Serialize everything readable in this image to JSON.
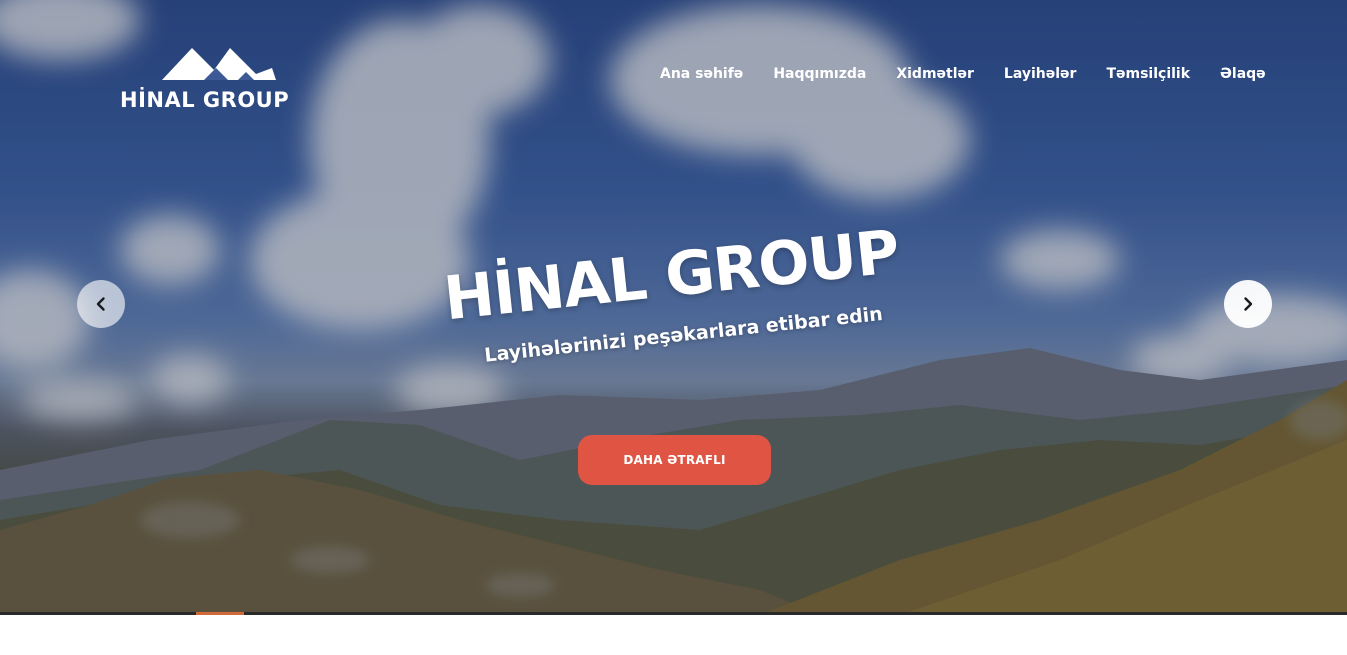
{
  "brand": {
    "name": "HİNAL GROUP",
    "accent_color": "#e05444"
  },
  "nav": {
    "items": [
      {
        "label": "Ana səhifə",
        "name": "nav-item-home"
      },
      {
        "label": "Haqqımızda",
        "name": "nav-item-about"
      },
      {
        "label": "Xidmətlər",
        "name": "nav-item-services"
      },
      {
        "label": "Layihələr",
        "name": "nav-item-projects"
      },
      {
        "label": "Təmsilçilik",
        "name": "nav-item-representation"
      },
      {
        "label": "Əlaqə",
        "name": "nav-item-contact"
      }
    ]
  },
  "hero": {
    "title": "HİNAL GROUP",
    "subtitle": "Layihələrinizi peşəkarlara etibar edin",
    "cta_label": "DAHA ƏTRAFLI",
    "prev_icon": "chevron-left-icon",
    "next_icon": "chevron-right-icon"
  },
  "slider": {
    "progress_color": "#d06a38"
  }
}
